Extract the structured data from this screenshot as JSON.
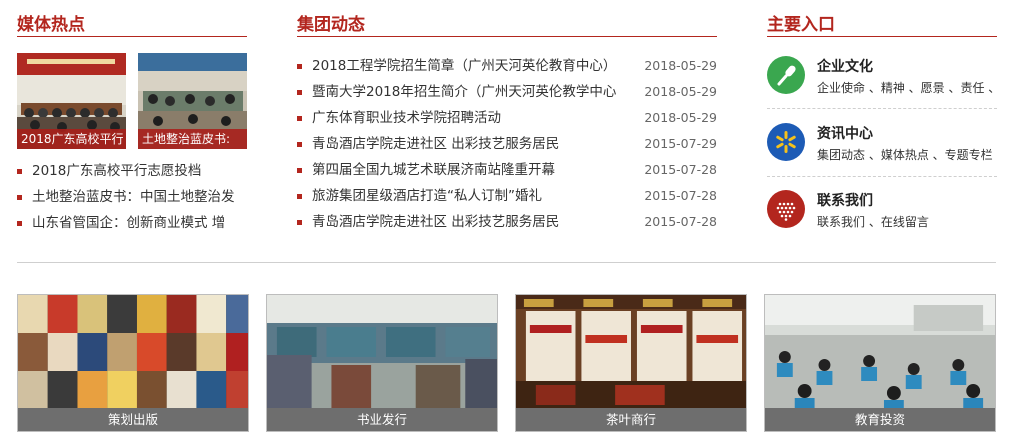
{
  "media": {
    "title": "媒体热点",
    "thumbs": [
      {
        "caption": "2018广东高校平行"
      },
      {
        "caption": "土地整治蓝皮书:"
      }
    ],
    "items": [
      {
        "text": "2018广东高校平行志愿投档"
      },
      {
        "text": "土地整治蓝皮书：中国土地整治发"
      },
      {
        "text": "山东省管国企：创新商业模式 增"
      }
    ]
  },
  "group_news": {
    "title": "集团动态",
    "items": [
      {
        "text": "2018工程学院招生简章（广州天河英伦教育中心）",
        "date": "2018-05-29"
      },
      {
        "text": "暨南大学2018年招生简介（广州天河英伦教学中心",
        "date": "2018-05-29"
      },
      {
        "text": "广东体育职业技术学院招聘活动",
        "date": "2018-05-29"
      },
      {
        "text": "青岛酒店学院走进社区 出彩技艺服务居民",
        "date": "2015-07-29"
      },
      {
        "text": "第四届全国九城艺术联展济南站隆重开幕",
        "date": "2015-07-28"
      },
      {
        "text": "旅游集团星级酒店打造“私人订制”婚礼",
        "date": "2015-07-28"
      },
      {
        "text": "青岛酒店学院走进社区 出彩技艺服务居民",
        "date": "2015-07-28"
      }
    ]
  },
  "entrances": {
    "title": "主要入口",
    "items": [
      {
        "title": "企业文化",
        "sub": "企业使命 、精神 、愿景 、责任 、",
        "icon": "microphone-icon",
        "color": "#3aa74f"
      },
      {
        "title": "资讯中心",
        "sub": "集团动态 、媒体热点 、专题专栏",
        "icon": "spark-icon",
        "color": "#1d5bb5"
      },
      {
        "title": "联系我们",
        "sub": "联系我们 、在线留言",
        "icon": "heart-icon",
        "color": "#b3261e"
      }
    ]
  },
  "tiles": [
    {
      "caption": "策划出版"
    },
    {
      "caption": "书业发行"
    },
    {
      "caption": "茶叶商行"
    },
    {
      "caption": "教育投资"
    }
  ],
  "colors": {
    "accent": "#b3261e",
    "caption_bg": "#6e6e6e"
  }
}
